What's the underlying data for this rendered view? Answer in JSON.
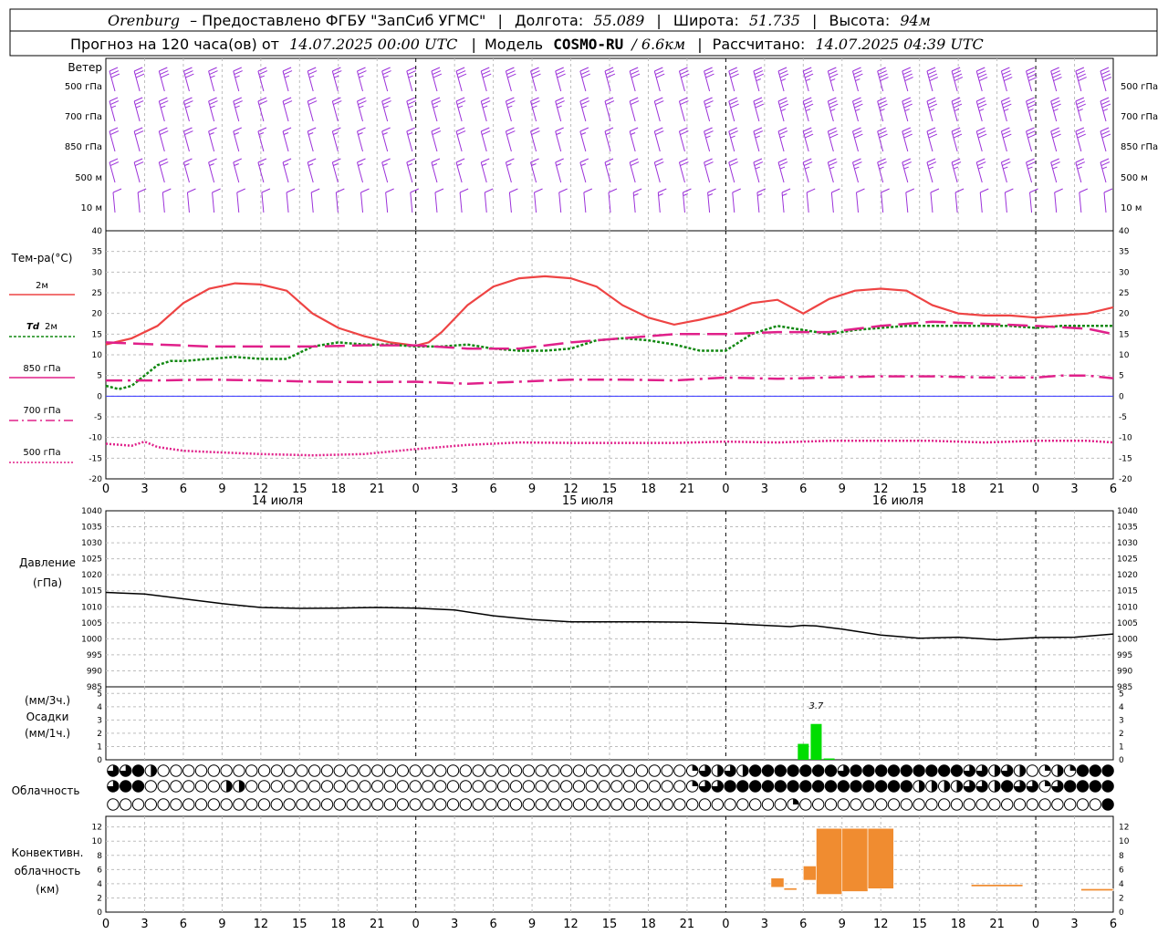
{
  "header": {
    "station": "Orenburg",
    "provided_by": "– Предоставлено ФГБУ \"ЗапСиб УГМС\"",
    "lon_label": "Долгота:",
    "lon_value": "55.089",
    "lat_label": "Широта:",
    "lat_value": "51.735",
    "alt_label": "Высота:",
    "alt_value": "94м",
    "forecast_label": "Прогноз на 120 часа(ов) от",
    "forecast_start": "14.07.2025 00:00 UTC",
    "model_label": "Модель",
    "model_name": "COSMO-RU",
    "model_res": "/ 6.6км",
    "calc_label": "Рассчитано:",
    "calc_time": "14.07.2025 04:39 UTC",
    "sep": "|"
  },
  "labels": {
    "wind": "Ветер",
    "levels": [
      "500 гПа",
      "700 гПа",
      "850 гПа",
      "500 м",
      "10 м"
    ],
    "temp_title": "Тем-ра(°С)",
    "t2m": "2м",
    "td_label": "Td",
    "td_level": "2м",
    "t850": "850 гПа",
    "t700": "700 гПа",
    "t500": "500 гПа",
    "pressure_1": "Давление",
    "pressure_2": "(гПа)",
    "precip_1": "(мм/3ч.)",
    "precip_2": "Осадки",
    "precip_3": "(мм/1ч.)",
    "precip_max_label": "3.7",
    "clouds": "Облачность",
    "conv_1": "Конвективн.",
    "conv_2": "облачность",
    "conv_3": "(км)",
    "days": [
      "14 июля",
      "15 июля",
      "16 июля"
    ],
    "hour_ticks": [
      "0",
      "3",
      "6",
      "9",
      "12",
      "15",
      "18",
      "21",
      "0",
      "3",
      "6",
      "9",
      "12",
      "15",
      "18",
      "21",
      "0",
      "3",
      "6",
      "9",
      "12",
      "15",
      "18",
      "21",
      "0",
      "3",
      "6"
    ],
    "temp_ticks": [
      "40",
      "35",
      "30",
      "25",
      "20",
      "15",
      "10",
      "5",
      "0",
      "-5",
      "-10",
      "-15",
      "-20"
    ],
    "pres_ticks": [
      "1040",
      "1035",
      "1030",
      "1025",
      "1020",
      "1015",
      "1010",
      "1005",
      "1000",
      "995",
      "990",
      "985"
    ],
    "precip_ticks": [
      "5",
      "4",
      "3",
      "2",
      "1",
      "0"
    ],
    "conv_ticks": [
      "12",
      "10",
      "8",
      "6",
      "4",
      "2",
      "0"
    ]
  },
  "colors": {
    "wind": "#9b30d9",
    "t2m": "#ee4444",
    "td2m": "#118811",
    "t850": "#e0208a",
    "t700": "#e0208a",
    "t500": "#e0208a",
    "zero_line": "#3333ff",
    "pressure": "#000000",
    "precip": "#00dd00",
    "convective": "#f08c30"
  },
  "chart_data": [
    {
      "type": "line",
      "panel": "temperature",
      "xlabel": "",
      "ylabel": "Тем-ра(°С)",
      "ylim": [
        -20,
        40
      ],
      "xlim": [
        0,
        78
      ],
      "series": [
        {
          "name": "2м",
          "x": [
            0,
            2,
            4,
            6,
            8,
            10,
            12,
            14,
            16,
            18,
            20,
            22,
            24,
            25,
            26,
            28,
            30,
            32,
            34,
            36,
            38,
            40,
            42,
            44,
            46,
            48,
            50,
            52,
            54,
            56,
            58,
            60,
            62,
            64,
            66,
            68,
            70,
            72,
            74,
            76,
            78
          ],
          "values": [
            12.5,
            14,
            17,
            22.5,
            26,
            27.3,
            27,
            25.5,
            20,
            16.5,
            14.5,
            13,
            12.2,
            13,
            15.5,
            22,
            26.5,
            28.5,
            29,
            28.5,
            26.5,
            22,
            19,
            17.3,
            18.5,
            20,
            22.5,
            23.3,
            20,
            23.5,
            25.5,
            26,
            25.5,
            22,
            20,
            19.5,
            19.5,
            19,
            19.5,
            20,
            21.5
          ]
        },
        {
          "name": "Td 2м",
          "x": [
            0,
            1,
            2,
            3,
            4,
            5,
            6,
            8,
            10,
            12,
            14,
            16,
            18,
            20,
            22,
            24,
            26,
            28,
            30,
            32,
            34,
            36,
            38,
            40,
            42,
            44,
            46,
            48,
            50,
            52,
            54,
            56,
            58,
            60,
            62,
            64,
            66,
            68,
            70,
            72,
            74,
            76,
            78
          ],
          "values": [
            2.5,
            1.7,
            2.5,
            5,
            7.5,
            8.5,
            8.5,
            9,
            9.5,
            9,
            9,
            12,
            13,
            12.5,
            12.5,
            12,
            12,
            12.5,
            11.5,
            11,
            11,
            11.5,
            13.5,
            14,
            13.5,
            12.5,
            11,
            11,
            15,
            17,
            16,
            15,
            16,
            16.5,
            17,
            17,
            17,
            17,
            17,
            16.5,
            17,
            17,
            17
          ]
        },
        {
          "name": "850 гПа",
          "x": [
            0,
            4,
            8,
            12,
            16,
            20,
            24,
            28,
            32,
            36,
            40,
            44,
            48,
            52,
            56,
            60,
            64,
            68,
            72,
            76,
            78
          ],
          "values": [
            13,
            12.5,
            12,
            12,
            12,
            12.3,
            12.3,
            11.5,
            11.5,
            13,
            14,
            15,
            15,
            15.5,
            15.5,
            17,
            18,
            17.5,
            17,
            16.3,
            15
          ]
        },
        {
          "name": "700 гПа",
          "x": [
            0,
            4,
            8,
            12,
            16,
            20,
            24,
            28,
            32,
            36,
            40,
            44,
            48,
            52,
            56,
            60,
            64,
            68,
            72,
            74,
            76,
            78
          ],
          "values": [
            3.8,
            3.8,
            4,
            3.8,
            3.5,
            3.4,
            3.5,
            3,
            3.5,
            4,
            4,
            3.8,
            4.5,
            4.2,
            4.5,
            4.8,
            4.8,
            4.5,
            4.5,
            5,
            5,
            4.3
          ]
        },
        {
          "name": "500 гПа",
          "x": [
            0,
            2,
            3,
            4,
            6,
            8,
            12,
            16,
            20,
            24,
            28,
            32,
            36,
            40,
            44,
            48,
            52,
            56,
            60,
            64,
            68,
            72,
            76,
            78
          ],
          "values": [
            -11.5,
            -12,
            -11,
            -12.3,
            -13.2,
            -13.5,
            -14,
            -14.3,
            -14,
            -12.8,
            -11.8,
            -11.2,
            -11.3,
            -11.3,
            -11.3,
            -11,
            -11.2,
            -10.8,
            -10.8,
            -10.8,
            -11.2,
            -10.8,
            -10.8,
            -11.2
          ]
        }
      ]
    },
    {
      "type": "line",
      "panel": "pressure",
      "ylabel": "Давление (гПа)",
      "ylim": [
        985,
        1040
      ],
      "xlim": [
        0,
        78
      ],
      "series": [
        {
          "name": "Давление",
          "x": [
            0,
            3,
            6,
            9,
            12,
            15,
            18,
            21,
            24,
            27,
            30,
            33,
            36,
            39,
            42,
            45,
            48,
            51,
            53,
            54,
            55,
            57,
            60,
            63,
            66,
            69,
            72,
            75,
            78
          ],
          "values": [
            1014.5,
            1014,
            1012.5,
            1011,
            1009.8,
            1009.5,
            1009.6,
            1009.8,
            1009.6,
            1009,
            1007.2,
            1006,
            1005.3,
            1005.3,
            1005.3,
            1005.2,
            1004.8,
            1004.2,
            1003.8,
            1004.2,
            1004,
            1003,
            1001.2,
            1000.2,
            1000.5,
            999.7,
            1000.4,
            1000.5,
            1001.5
          ]
        }
      ]
    },
    {
      "type": "bar",
      "panel": "precipitation",
      "ylabel": "(мм/3ч.) Осадки (мм/1ч.)",
      "ylim": [
        0,
        5
      ],
      "x": [
        54,
        55,
        56
      ],
      "values": [
        1.2,
        2.7,
        0.1
      ],
      "annotation": "3.7"
    },
    {
      "type": "bar",
      "panel": "convective_cloud",
      "ylabel": "Конвективн. облачность (км)",
      "ylim": [
        0,
        13
      ],
      "bars": [
        {
          "x0": 51.5,
          "x1": 52.5,
          "bottom": 3.5,
          "top": 4.8
        },
        {
          "x0": 52.5,
          "x1": 53.5,
          "bottom": 3.1,
          "top": 3.4
        },
        {
          "x0": 54.0,
          "x1": 55.0,
          "bottom": 4.5,
          "top": 6.5
        },
        {
          "x0": 55.0,
          "x1": 57.0,
          "bottom": 2.5,
          "top": 11.8
        },
        {
          "x0": 57.0,
          "x1": 59.0,
          "bottom": 2.9,
          "top": 11.8
        },
        {
          "x0": 59.0,
          "x1": 61.0,
          "bottom": 3.3,
          "top": 11.8
        },
        {
          "x0": 67.0,
          "x1": 71.0,
          "bottom": 3.6,
          "top": 3.9
        },
        {
          "x0": 75.5,
          "x1": 78.0,
          "bottom": 3.0,
          "top": 3.3
        }
      ]
    },
    {
      "type": "table",
      "panel": "cloud_cover",
      "rows": [
        {
          "name": "upper",
          "cover": [
            0.75,
            0.75,
            1,
            0.5,
            0,
            0,
            0,
            0,
            0,
            0,
            0,
            0,
            0,
            0,
            0,
            0,
            0,
            0,
            0,
            0,
            0,
            0,
            0,
            0,
            0,
            0,
            0,
            0,
            0,
            0,
            0,
            0,
            0,
            0,
            0,
            0,
            0,
            0,
            0,
            0,
            0,
            0,
            0,
            0,
            0,
            0,
            0.25,
            0.75,
            0.5,
            0.75,
            0.5,
            1,
            1,
            1,
            1,
            1,
            1,
            1,
            0.75,
            1,
            1,
            1,
            1,
            1,
            1,
            1,
            1,
            1,
            0.75,
            0.75,
            0.5,
            0.75,
            0.5,
            0,
            0.25,
            0.5,
            0.25,
            1,
            1,
            1
          ]
        },
        {
          "name": "middle",
          "cover": [
            0.75,
            1,
            1,
            0,
            0,
            0,
            0,
            0,
            0,
            0.5,
            0.5,
            0,
            0,
            0,
            0,
            0,
            0,
            0,
            0,
            0,
            0,
            0,
            0,
            0,
            0,
            0,
            0,
            0,
            0,
            0,
            0,
            0,
            0,
            0,
            0,
            0,
            0,
            0,
            0,
            0,
            0,
            0,
            0,
            0,
            0,
            0,
            0.25,
            0.75,
            0.75,
            1,
            1,
            1,
            1,
            1,
            1,
            1,
            1,
            1,
            1,
            1,
            1,
            1,
            1,
            1,
            0.5,
            0.5,
            0.5,
            0.5,
            0.75,
            0.75,
            0.5,
            1,
            0.75,
            0.75,
            0.25,
            0.75,
            1,
            1,
            1,
            1
          ]
        },
        {
          "name": "lower",
          "cover": [
            0,
            0,
            0,
            0,
            0,
            0,
            0,
            0,
            0,
            0,
            0,
            0,
            0,
            0,
            0,
            0,
            0,
            0,
            0,
            0,
            0,
            0,
            0,
            0,
            0,
            0,
            0,
            0,
            0,
            0,
            0,
            0,
            0,
            0,
            0,
            0,
            0,
            0,
            0,
            0,
            0,
            0,
            0,
            0,
            0,
            0,
            0,
            0,
            0,
            0,
            0,
            0,
            0,
            0,
            0.25,
            0,
            0,
            0,
            0,
            0,
            0,
            0,
            0,
            0,
            0,
            0,
            0,
            0,
            0,
            0,
            0,
            0,
            0,
            0,
            0,
            0,
            0,
            0,
            0,
            1
          ]
        }
      ]
    },
    {
      "type": "barbs",
      "panel": "wind",
      "levels": [
        "500 гПа",
        "700 гПа",
        "850 гПа",
        "500 м",
        "10 м"
      ],
      "speed_ms": [
        [
          12,
          12,
          12,
          12,
          10,
          10,
          10,
          10,
          10,
          10,
          10,
          10,
          10,
          12,
          12,
          12,
          12,
          12,
          12,
          12,
          12,
          12,
          12,
          12,
          12,
          12,
          14,
          14,
          14,
          14,
          14,
          16,
          16,
          16,
          16,
          16,
          16,
          16,
          16,
          16,
          16
        ],
        [
          10,
          10,
          10,
          10,
          10,
          10,
          8,
          8,
          8,
          8,
          10,
          10,
          10,
          10,
          10,
          10,
          10,
          10,
          10,
          10,
          8,
          8,
          8,
          8,
          10,
          12,
          12,
          14,
          14,
          14,
          14,
          14,
          14,
          14,
          14,
          14,
          14,
          14,
          14,
          14,
          14
        ],
        [
          8,
          8,
          8,
          8,
          6,
          6,
          6,
          6,
          6,
          6,
          6,
          6,
          6,
          8,
          8,
          8,
          8,
          8,
          6,
          6,
          6,
          6,
          8,
          8,
          10,
          10,
          10,
          10,
          12,
          12,
          12,
          12,
          12,
          12,
          12,
          12,
          12,
          12,
          12,
          12,
          12
        ],
        [
          8,
          8,
          8,
          6,
          6,
          6,
          6,
          6,
          6,
          6,
          6,
          6,
          6,
          6,
          6,
          6,
          6,
          6,
          6,
          6,
          6,
          8,
          8,
          8,
          8,
          8,
          10,
          10,
          10,
          10,
          10,
          10,
          10,
          10,
          10,
          10,
          10,
          10,
          10,
          10,
          10
        ],
        [
          4,
          4,
          4,
          4,
          4,
          4,
          4,
          4,
          4,
          4,
          4,
          4,
          4,
          4,
          4,
          4,
          4,
          4,
          4,
          4,
          4,
          6,
          6,
          6,
          6,
          4,
          6,
          6,
          4,
          4,
          4,
          4,
          4,
          4,
          4,
          4,
          4,
          4,
          4,
          4,
          4
        ]
      ]
    }
  ]
}
